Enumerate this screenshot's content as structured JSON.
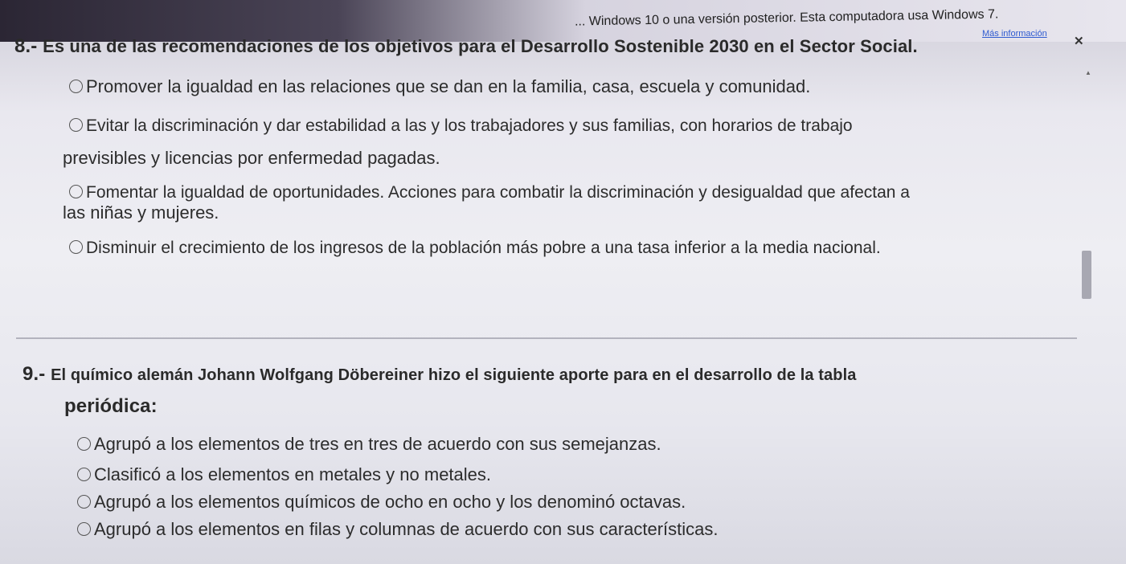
{
  "notice": {
    "text": "... Windows 10 o una versión posterior. Esta computadora usa Windows 7.",
    "link": "Más información",
    "close": "✕"
  },
  "questions": [
    {
      "number": "8.-",
      "title": "Es una de las recomendaciones de los objetivos para el Desarrollo Sostenible 2030 en el Sector Social.",
      "options": [
        {
          "lines": [
            "Promover la igualdad en las relaciones que se dan en la familia, casa, escuela y comunidad."
          ]
        },
        {
          "lines": [
            "Evitar la discriminación y dar estabilidad a las y los trabajadores y sus familias, con horarios de trabajo",
            "previsibles y licencias por enfermedad pagadas."
          ]
        },
        {
          "lines": [
            "Fomentar la igualdad de oportunidades. Acciones para combatir la discriminación y desigualdad que afectan a",
            "las niñas y mujeres."
          ]
        },
        {
          "lines": [
            "Disminuir el crecimiento de los ingresos de la población más pobre a una tasa inferior a la media nacional."
          ]
        }
      ]
    },
    {
      "number": "9.-",
      "title": "El químico alemán Johann Wolfgang Döbereiner hizo el siguiente aporte para en el desarrollo de la tabla",
      "title_line2": "periódica:",
      "options": [
        {
          "lines": [
            "Agrupó a los elementos de tres en tres de acuerdo con sus semejanzas."
          ]
        },
        {
          "lines": [
            "Clasificó a los elementos en metales y no metales."
          ]
        },
        {
          "lines": [
            "Agrupó a los elementos químicos de ocho en ocho y los denominó octavas."
          ]
        },
        {
          "lines": [
            "Agrupó a los elementos en filas y columnas de acuerdo con sus características."
          ]
        }
      ]
    }
  ]
}
